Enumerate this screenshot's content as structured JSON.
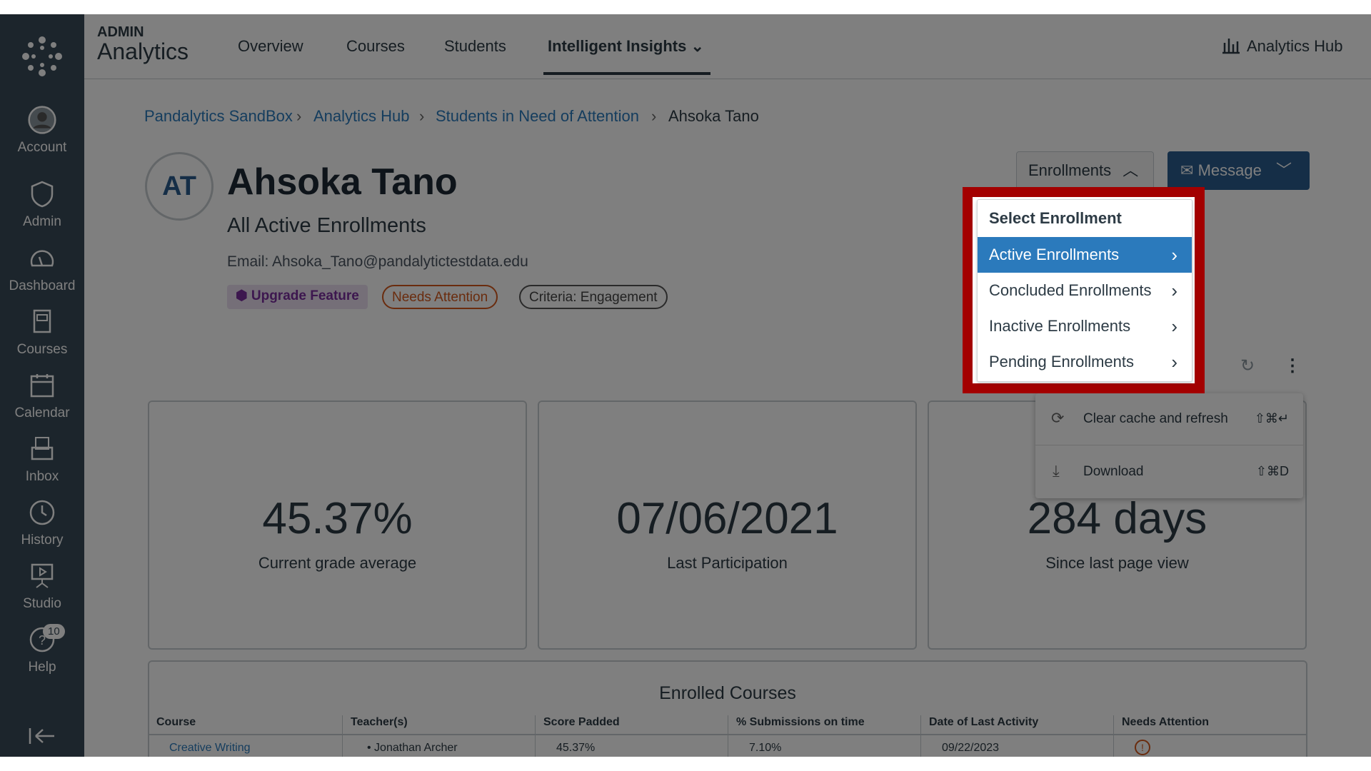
{
  "header": {
    "admin": "ADMIN",
    "app": "Analytics",
    "tabs": [
      "Overview",
      "Courses",
      "Students",
      "Intelligent Insights"
    ],
    "hub": "Analytics Hub"
  },
  "sidebar": {
    "items": [
      {
        "label": "Account"
      },
      {
        "label": "Admin"
      },
      {
        "label": "Dashboard"
      },
      {
        "label": "Courses"
      },
      {
        "label": "Calendar"
      },
      {
        "label": "Inbox"
      },
      {
        "label": "History"
      },
      {
        "label": "Studio"
      },
      {
        "label": "Help",
        "badge": "10"
      }
    ]
  },
  "breadcrumb": [
    "Pandalytics SandBox",
    "Analytics Hub",
    "Students in Need of Attention",
    "Ahsoka Tano"
  ],
  "student": {
    "initials": "AT",
    "name": "Ahsoka Tano",
    "subtitle": "All Active Enrollments",
    "email": "Email: Ahsoka_Tano@pandalytictestdata.edu",
    "badges": [
      "Upgrade Feature",
      "Needs Attention",
      "Criteria: Engagement"
    ]
  },
  "buttons": {
    "enrollments": "Enrollments",
    "message": "Message"
  },
  "enrollment_menu": {
    "title": "Select Enrollment",
    "items": [
      "Active Enrollments",
      "Concluded Enrollments",
      "Inactive Enrollments",
      "Pending Enrollments"
    ],
    "selected": "Active Enrollments"
  },
  "context_menu": [
    {
      "label": "Clear cache and refresh",
      "shortcut": "⇧⌘↵"
    },
    {
      "label": "Download",
      "shortcut": "⇧⌘D"
    }
  ],
  "cards": [
    {
      "value": "45.37%",
      "label": "Current grade average"
    },
    {
      "value": "07/06/2021",
      "label": "Last Participation"
    },
    {
      "value": "284 days",
      "label": "Since last page view"
    }
  ],
  "courses": {
    "title": "Enrolled Courses",
    "columns": [
      "Course",
      "Teacher(s)",
      "Score Padded",
      "% Submissions on time",
      "Date of Last Activity",
      "Needs Attention"
    ],
    "rows": [
      [
        "Creative Writing",
        "Jonathan Archer",
        "45.37%",
        "7.10%",
        "09/22/2023",
        ""
      ]
    ]
  },
  "colors": {
    "accent": "#2b7abc",
    "highlight": "#a30000",
    "sidebar": "#394b58",
    "message": "#2b5d8f"
  }
}
